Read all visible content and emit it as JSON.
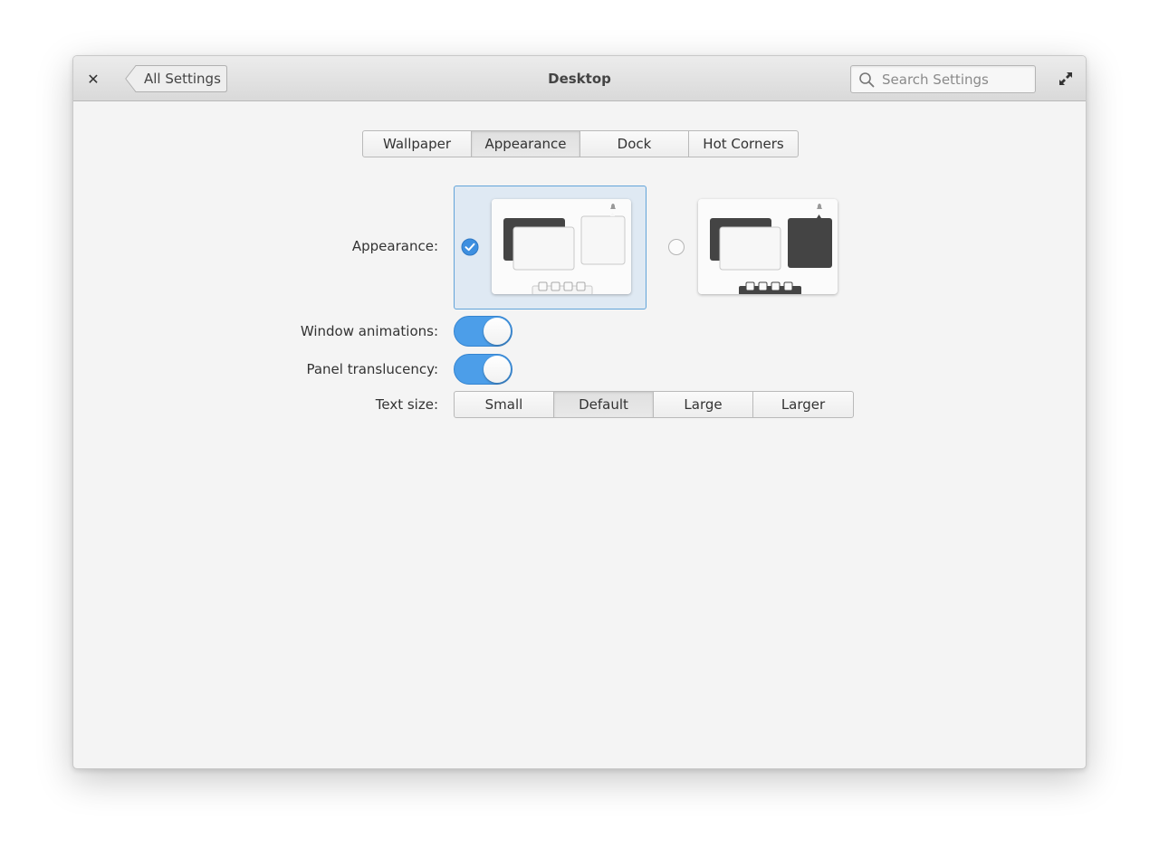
{
  "window": {
    "title": "Desktop",
    "back_label": "All Settings",
    "search_placeholder": "Search Settings"
  },
  "tabs": [
    {
      "label": "Wallpaper",
      "active": false
    },
    {
      "label": "Appearance",
      "active": true
    },
    {
      "label": "Dock",
      "active": false
    },
    {
      "label": "Hot Corners",
      "active": false
    }
  ],
  "settings": {
    "appearance_label": "Appearance:",
    "selected_style": "light",
    "window_animations_label": "Window animations:",
    "window_animations_on": true,
    "panel_translucency_label": "Panel translucency:",
    "panel_translucency_on": true,
    "text_size_label": "Text size:",
    "text_sizes": [
      "Small",
      "Default",
      "Large",
      "Larger"
    ],
    "text_size_selected": "Default"
  },
  "colors": {
    "accent": "#4c9ee9",
    "selected_bg": "#dfe9f3",
    "dark_window": "#444444"
  }
}
